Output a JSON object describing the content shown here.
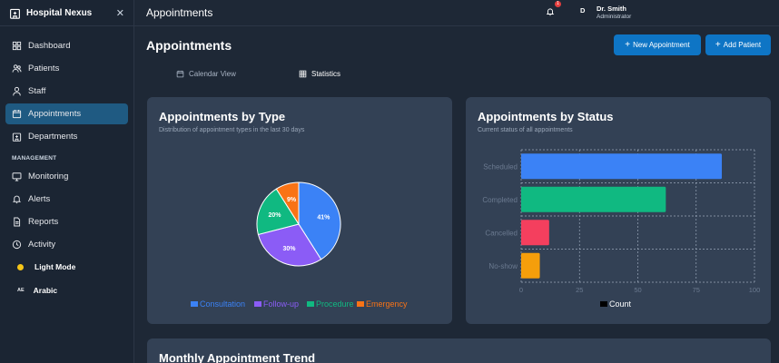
{
  "app": {
    "name": "Hospital Nexus",
    "close_glyph": "✕"
  },
  "sidebar": {
    "items": [
      {
        "label": "Dashboard",
        "icon": "dashboard-icon"
      },
      {
        "label": "Patients",
        "icon": "users-icon"
      },
      {
        "label": "Staff",
        "icon": "user-icon"
      },
      {
        "label": "Appointments",
        "icon": "calendar-icon",
        "active": true
      },
      {
        "label": "Departments",
        "icon": "building-icon"
      }
    ],
    "section_label": "MANAGEMENT",
    "management_items": [
      {
        "label": "Monitoring",
        "icon": "monitor-icon"
      },
      {
        "label": "Alerts",
        "icon": "bell-icon"
      },
      {
        "label": "Reports",
        "icon": "document-icon"
      },
      {
        "label": "Activity",
        "icon": "clock-icon"
      }
    ],
    "theme_label": "Light Mode",
    "language_glyph": "AE",
    "language_label": "Arabic"
  },
  "header": {
    "title": "Appointments",
    "notification_count": "1",
    "avatar_initial": "D",
    "user_name": "Dr. Smith",
    "user_role": "Administrator"
  },
  "main": {
    "title": "Appointments",
    "new_appointment_label": "New Appointment",
    "add_patient_label": "Add Patient",
    "tabs": [
      {
        "label": "Calendar View",
        "active": false
      },
      {
        "label": "Statistics",
        "active": true
      }
    ]
  },
  "colors": {
    "accent": "#0e75c5",
    "consultation": "#3b82f6",
    "follow_up": "#8b5cf6",
    "procedure": "#10b981",
    "emergency": "#f97316",
    "scheduled": "#3b82f6",
    "completed": "#10b981",
    "cancelled": "#f43f5e",
    "no_show": "#f59e0b"
  },
  "chart_data": [
    {
      "type": "pie",
      "title": "Appointments by Type",
      "subtitle": "Distribution of appointment types in the last 30 days",
      "categories": [
        "Consultation",
        "Follow-up",
        "Procedure",
        "Emergency"
      ],
      "values": [
        41,
        30,
        20,
        9
      ],
      "labels": [
        "41%",
        "30%",
        "20%",
        "9%"
      ],
      "colors": [
        "#3b82f6",
        "#8b5cf6",
        "#10b981",
        "#f97316"
      ],
      "legend": "bottom"
    },
    {
      "type": "bar",
      "orientation": "horizontal",
      "title": "Appointments by Status",
      "subtitle": "Current status of all appointments",
      "categories": [
        "Scheduled",
        "Completed",
        "Cancelled",
        "No-show"
      ],
      "series": [
        {
          "name": "Count",
          "values": [
            86,
            62,
            12,
            8
          ]
        }
      ],
      "colors": [
        "#3b82f6",
        "#10b981",
        "#f43f5e",
        "#f59e0b"
      ],
      "xlim": [
        0,
        100
      ],
      "xticks": [
        "0",
        "25",
        "50",
        "75",
        "100"
      ],
      "grid": true,
      "legend": "bottom"
    }
  ],
  "trend": {
    "title": "Monthly Appointment Trend"
  }
}
